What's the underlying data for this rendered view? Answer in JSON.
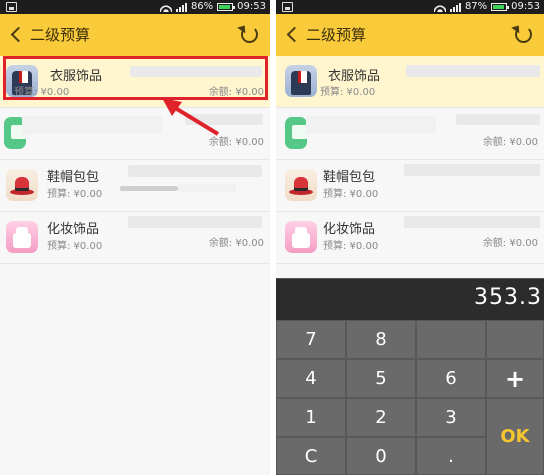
{
  "left_screen": {
    "status": {
      "battery": "86%",
      "time": "09:53"
    },
    "title": "二级预算",
    "items": [
      {
        "name": "衣服饰品",
        "budget": "预算: ¥0.00",
        "balance": "余额: ¥0.00"
      },
      {
        "name": "",
        "budget": "",
        "balance": "余额: ¥0.00"
      },
      {
        "name": "鞋帽包包",
        "budget": "预算: ¥0.00",
        "balance": ""
      },
      {
        "name": "化妆饰品",
        "budget": "预算: ¥0.00",
        "balance": "余额: ¥0.00"
      }
    ]
  },
  "right_screen": {
    "status": {
      "battery": "87%",
      "time": "09:53"
    },
    "title": "二级预算",
    "items": [
      {
        "name": "衣服饰品",
        "budget": "预算: ¥0.00",
        "balance": ""
      },
      {
        "name": "",
        "budget": "",
        "balance": "余额: ¥0.00"
      },
      {
        "name": "鞋帽包包",
        "budget": "预算: ¥0.00",
        "balance": ""
      },
      {
        "name": "化妆饰品",
        "budget": "预算: ¥0.00",
        "balance": "余额: ¥0.00"
      }
    ],
    "keypad": {
      "display": "353.3",
      "keys": [
        "7",
        "8",
        "4",
        "5",
        "6",
        "+",
        "1",
        "2",
        "3",
        "OK",
        "C",
        "0",
        "."
      ]
    }
  },
  "colors": {
    "accent": "#f9cb3b",
    "highlight": "#e0222b",
    "ok": "#f5c530",
    "keypad": "#5e5e5e"
  }
}
